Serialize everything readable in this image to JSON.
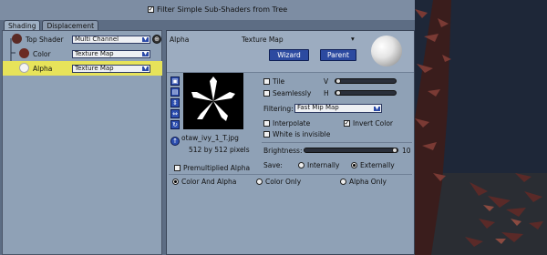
{
  "toolbar": {
    "filter_label": "Filter Simple Sub-Shaders from Tree",
    "filter_checked": "✓"
  },
  "tabs": [
    {
      "label": "Shading"
    },
    {
      "label": "Displacement"
    }
  ],
  "tree": {
    "items": [
      {
        "label": "Top Shader",
        "value": "Multi Channel",
        "ball": "#5b2a24"
      },
      {
        "label": "Color",
        "value": "Texture Map",
        "ball": "#6b2a22"
      },
      {
        "label": "Alpha",
        "value": "Texture Map",
        "ball": "#f4f4f4"
      }
    ],
    "arrow": "▼"
  },
  "panel": {
    "channel": "Alpha",
    "title": "Texture Map",
    "menu_arrow": "▾",
    "wizard": "Wizard",
    "parent": "Parent",
    "filename": "otaw_ivy_1_T.jpg",
    "dimensions": "512 by 512 pixels",
    "tile": "Tile",
    "seamlessly": "Seamlessly",
    "v": "V",
    "h": "H",
    "filtering_label": "Filtering:",
    "filtering_value": "Fast Mip Map",
    "interpolate": "Interpolate",
    "invert_color": "Invert Color",
    "invert_checked": "✓",
    "white_invisible": "White is invisible",
    "brightness_label": "Brightness:",
    "brightness_value": "10",
    "save_label": "Save:",
    "internally": "Internally",
    "externally": "Externally",
    "premultiplied": "Premultiplied Alpha",
    "color_and_alpha": "Color And Alpha",
    "color_only": "Color Only",
    "alpha_only": "Alpha Only",
    "icons": [
      "open-folder-icon",
      "save-icon",
      "swap-vertical-icon",
      "swap-horizontal-icon",
      "rotate-icon",
      "up-arrow-icon"
    ],
    "icon_glyphs": [
      "▣",
      "▤",
      "⇕",
      "⇔",
      "↻",
      "↑"
    ]
  },
  "colors": {
    "selected_row": "#e7e35a",
    "button": "#2c4aa0",
    "panel": "#8fa1b6"
  }
}
